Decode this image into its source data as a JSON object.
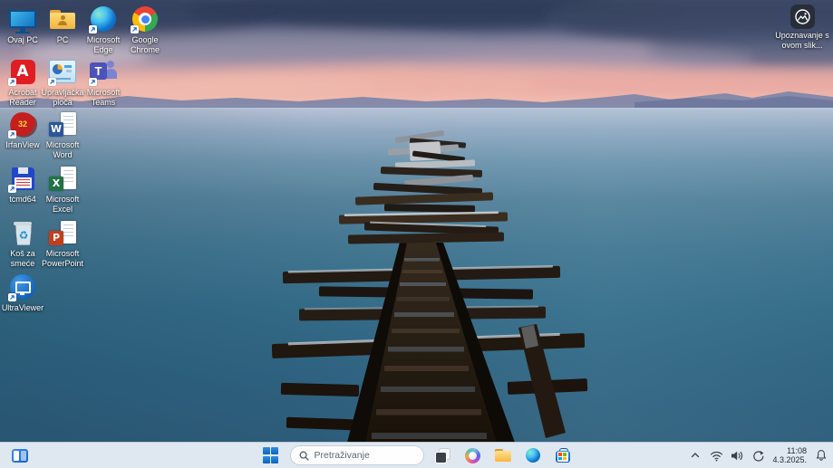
{
  "desktop": {
    "spotlight": {
      "label": "Upoznavanje s ovom slik...",
      "icon": "spotlight-image-icon"
    },
    "icons": [
      {
        "id": "ovaj-pc",
        "label": "Ovaj PC"
      },
      {
        "id": "pc-folder",
        "label": "PC"
      },
      {
        "id": "microsoft-edge",
        "label": "Microsoft Edge"
      },
      {
        "id": "google-chrome",
        "label": "Google Chrome"
      },
      {
        "id": "acrobat-reader",
        "label": "Acrobat Reader"
      },
      {
        "id": "upravljacka-ploca",
        "label": "Upravljačka ploča"
      },
      {
        "id": "microsoft-teams",
        "label": "Microsoft Teams"
      },
      {
        "id": "irfanview",
        "label": "IrfanView",
        "badge_text": "32"
      },
      {
        "id": "microsoft-word",
        "label": "Microsoft Word",
        "letter": "W"
      },
      {
        "id": "tcmd64",
        "label": "tcmd64"
      },
      {
        "id": "microsoft-excel",
        "label": "Microsoft Excel",
        "letter": "X"
      },
      {
        "id": "kos-za-smece",
        "label": "Koš za smeće",
        "glyph": "♻"
      },
      {
        "id": "microsoft-powerpoint",
        "label": "Microsoft PowerPoint",
        "letter": "P"
      },
      {
        "id": "ultraviewer",
        "label": "UltraViewer"
      }
    ]
  },
  "taskbar": {
    "left_icons": [
      "widgets-icon"
    ],
    "center_icons": [
      "start-icon",
      "search-input",
      "task-view-icon",
      "copilot-icon",
      "file-explorer-icon",
      "edge-icon",
      "microsoft-store-icon"
    ],
    "search_placeholder": "Pretraživanje",
    "tray": {
      "icons": [
        "chevron-up-icon",
        "wifi-icon",
        "volume-icon",
        "sync-icon",
        "bell-icon"
      ],
      "time": "11:08",
      "date": "4.3.2025."
    }
  },
  "office_letters": {
    "word": "W",
    "excel": "X",
    "powerpoint": "P"
  },
  "recycle_glyph": "♻",
  "irfanview_number": "32",
  "acrobat_letter": "A",
  "teams_letter": "T",
  "colors": {
    "taskbar_bg": "#ebf1f8",
    "water_deep": "#2d5c79",
    "sunset_pink": "#f0b9ae"
  }
}
